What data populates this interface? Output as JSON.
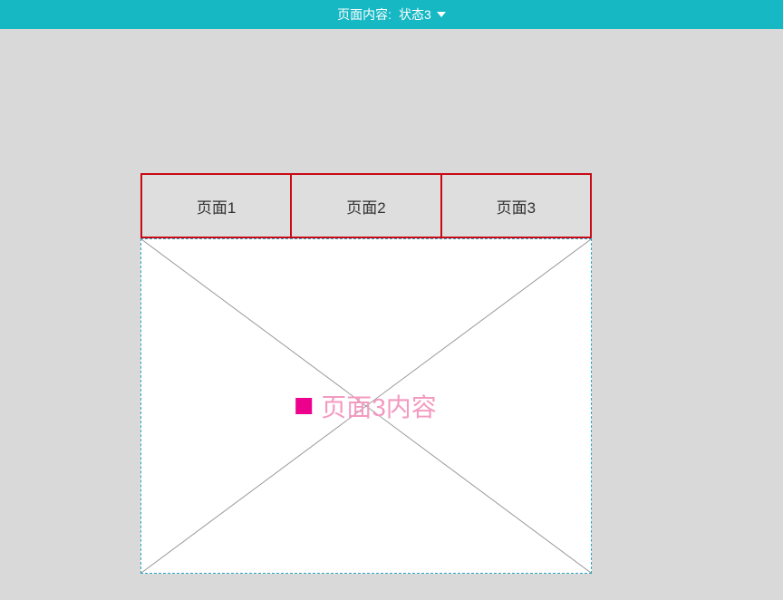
{
  "header": {
    "label": "页面内容:",
    "state_value": "状态3"
  },
  "tabs": {
    "items": [
      {
        "label": "页面1"
      },
      {
        "label": "页面2"
      },
      {
        "label": "页面3"
      }
    ]
  },
  "content": {
    "text": "页面3内容"
  }
}
